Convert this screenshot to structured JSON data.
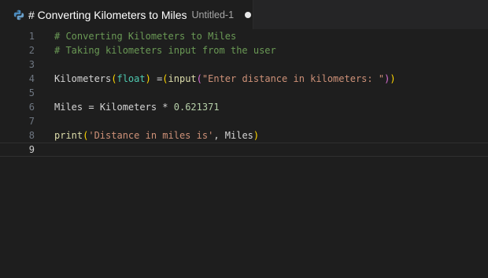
{
  "tab": {
    "title": "# Converting Kilometers to Miles",
    "description": "Untitled-1",
    "icon": "python-icon",
    "dirty": true
  },
  "editor": {
    "active_line": 9,
    "lines": [
      {
        "number": "1",
        "tokens": [
          {
            "t": "comment",
            "v": "# Converting Kilometers to Miles"
          }
        ]
      },
      {
        "number": "2",
        "tokens": [
          {
            "t": "comment",
            "v": "# Taking kilometers input from the user"
          }
        ]
      },
      {
        "number": "3",
        "tokens": []
      },
      {
        "number": "4",
        "tokens": [
          {
            "t": "ident",
            "v": "Kilometers"
          },
          {
            "t": "b1",
            "v": "("
          },
          {
            "t": "type",
            "v": "float"
          },
          {
            "t": "b1",
            "v": ")"
          },
          {
            "t": "op",
            "v": " ="
          },
          {
            "t": "b1",
            "v": "("
          },
          {
            "t": "func",
            "v": "input"
          },
          {
            "t": "b2",
            "v": "("
          },
          {
            "t": "str",
            "v": "\"Enter distance in kilometers: \""
          },
          {
            "t": "b2",
            "v": ")"
          },
          {
            "t": "b1",
            "v": ")"
          }
        ]
      },
      {
        "number": "5",
        "tokens": []
      },
      {
        "number": "6",
        "tokens": [
          {
            "t": "ident",
            "v": "Miles"
          },
          {
            "t": "op",
            "v": " = "
          },
          {
            "t": "ident",
            "v": "Kilometers"
          },
          {
            "t": "op",
            "v": " * "
          },
          {
            "t": "num",
            "v": "0.621371"
          }
        ]
      },
      {
        "number": "7",
        "tokens": []
      },
      {
        "number": "8",
        "tokens": [
          {
            "t": "func",
            "v": "print"
          },
          {
            "t": "b1",
            "v": "("
          },
          {
            "t": "str",
            "v": "'Distance in miles is'"
          },
          {
            "t": "op",
            "v": ", "
          },
          {
            "t": "ident",
            "v": "Miles"
          },
          {
            "t": "b1",
            "v": ")"
          }
        ]
      },
      {
        "number": "9",
        "tokens": []
      }
    ]
  }
}
